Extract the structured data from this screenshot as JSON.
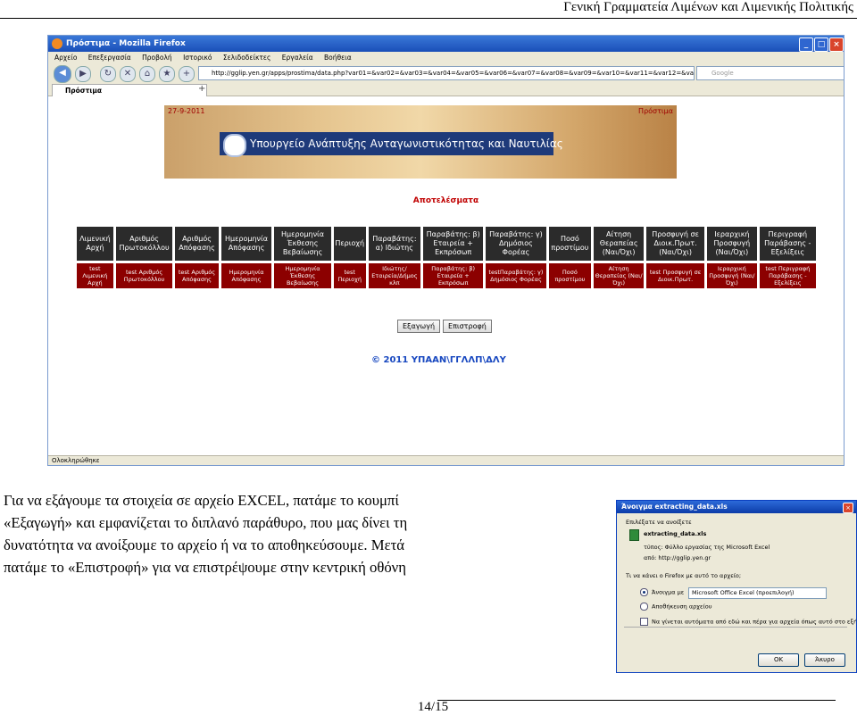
{
  "header": {
    "title": "Γενική Γραμματεία Λιμένων και Λιμενικής Πολιτικής"
  },
  "browser": {
    "window_title": "Πρόστιμα - Mozilla Firefox",
    "menu": [
      "Αρχείο",
      "Επεξεργασία",
      "Προβολή",
      "Ιστορικό",
      "Σελιδοδείκτες",
      "Εργαλεία",
      "Βοήθεια"
    ],
    "url": "http://gglip.yen.gr/apps/prostima/data.php?var01=&var02=&var03=&var04=&var05=&var06=&var07=&var08=&var09=&var10=&var11=&var12=&var13=",
    "search_placeholder": "Google",
    "tab_title": "Πρόστιμα",
    "page": {
      "date": "27-9-2011",
      "home_link": "Πρόστιμα",
      "ministry": "Υπουργείο Ανάπτυξης Ανταγωνιστικότητας και Ναυτιλίας",
      "results_title": "Αποτελέσματα",
      "columns": [
        "Λιμενική Αρχή",
        "Αριθμός Πρωτοκόλλου",
        "Αριθμός Απόφασης",
        "Ημερομηνία Απόφασης",
        "Ημερομηνία Έκθεσης Βεβαίωσης",
        "Περιοχή",
        "Παραβάτης: α) Ιδιώτης",
        "Παραβάτης: β) Εταιρεία + Εκπρόσωπ",
        "Παραβάτης: γ) Δημόσιος Φορέας",
        "Ποσό προστίμου",
        "Αίτηση Θεραπείας (Ναι/Όχι)",
        "Προσφυγή σε Διοικ.Πρωτ. (Ναι/Όχι)",
        "Ιεραρχική Προσφυγή (Ναι/Όχι)",
        "Περιγραφή Παράβασης - Εξελίξεις"
      ],
      "row": [
        "test Λιμενική Αρχή",
        "test Αριθμός Πρωτοκόλλου",
        "test Αριθμός Απόφασης",
        "Ημερομηνία Απόφασης",
        "Ημερομηνία Έκθεσης Βεβαίωσης",
        "test Περιοχή",
        "Ιδιώτης/Εταιρεία/Δήμος κλπ",
        "Παραβάτης: β) Εταιρεία + Εκπρόσωπ",
        "testΠαραβάτης: γ) Δημόσιος Φορέας",
        "Ποσό προστίμου",
        "Αίτηση Θεραπείας (Ναι/Όχι)",
        "test Προσφυγή σε Διοικ.Πρωτ.",
        "Ιεραρχική Προσφυγή (Ναι/Όχι)",
        "test Περιγραφή Παράβασης - Εξελίξεις"
      ],
      "export_button": "Εξαγωγή",
      "back_button": "Επιστροφή",
      "copyright": "© 2011 ΥΠΑΑΝ\\ΓΓΛΛΠ\\ΔΛΥ"
    },
    "status": "Ολοκληρώθηκε"
  },
  "body": {
    "paragraph_lines": [
      "Για να εξάγουμε τα στοιχεία σε αρχείο EXCEL, πατάμε το κουμπί",
      "«Εξαγωγή» και εμφανίζεται το διπλανό παράθυρο, που μας δίνει τη",
      "δυνατότητα να ανοίξουμε το αρχείο ή να το αποθηκεύσουμε. Μετά",
      "πατάμε το «Επιστροφή» για να επιστρέψουμε στην κεντρική οθόνη"
    ]
  },
  "dialog": {
    "title": "Άνοιγμα extracting_data.xls",
    "intro": "Επιλέξατε να ανοίξετε",
    "filename": "extracting_data.xls",
    "type_line": "τύπος: Φύλλο εργασίας της Microsoft Excel",
    "from_line": "από: http://gglip.yen.gr",
    "question": "Τι να κάνει ο Firefox με αυτό το αρχείο;",
    "open_with": "Άνοιγμα με",
    "open_with_app": "Microsoft Office Excel (προεπιλογή)",
    "save_file": "Αποθήκευση αρχείου",
    "auto_check": "Να γίνεται αυτόματα από εδώ και πέρα για αρχεία όπως αυτό στο εξής.",
    "ok": "ΟΚ",
    "cancel": "Άκυρο"
  },
  "footer": {
    "page": "14/15"
  }
}
